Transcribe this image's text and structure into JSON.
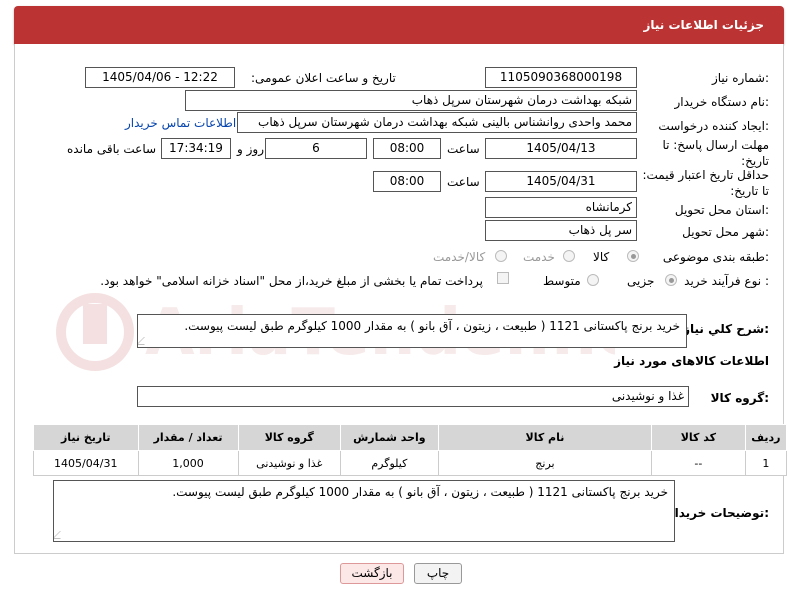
{
  "header": {
    "title": "جزئیات اطلاعات نیاز"
  },
  "fields": {
    "need_number_label": "شماره نیاز:",
    "need_number": "1105090368000198",
    "announce_label": "تاریخ و ساعت اعلان عمومی:",
    "announce_value": "1405/04/06 - 12:22",
    "buyer_org_label": "نام دستگاه خریدار:",
    "buyer_org": "شبکه بهداشت درمان شهرستان سرپل ذهاب",
    "creator_label": "ایجاد کننده درخواست:",
    "creator": "محمد واحدی روانشناس بالینی شبکه بهداشت درمان شهرستان سرپل ذهاب",
    "contact_link": "اطلاعات تماس خریدار",
    "deadline_label": "مهلت ارسال پاسخ: تا تاریخ:",
    "deadline_date": "1405/04/13",
    "time_word": "ساعت",
    "deadline_time": "08:00",
    "days_value": "6",
    "days_word": "روز و",
    "remaining_time": "17:34:19",
    "remaining_word": "ساعت باقی مانده",
    "price_validity_label": "حداقل تاریخ اعتبار قیمت: تا تاریخ:",
    "price_validity_date": "1405/04/31",
    "price_validity_time": "08:00",
    "province_label": "استان محل تحویل:",
    "province": "کرمانشاه",
    "city_label": "شهر محل تحویل:",
    "city": "سر پل ذهاب",
    "category_label": "طبقه بندی موضوعی:",
    "category_options": [
      "کالا",
      "خدمت",
      "کالا/خدمت"
    ],
    "process_label": "نوع فرآیند خرید :",
    "process_options": [
      "جزیی",
      "متوسط"
    ],
    "payment_note": "پرداخت تمام یا بخشی از مبلغ خرید،از محل \"اسناد خزانه اسلامی\" خواهد بود."
  },
  "summary": {
    "label": "شرح كلي نياز:",
    "text": "خرید برنج پاکستانی 1121 ( طبیعت ، زیتون ، آق بانو ) به مقدار 1000 کیلوگرم طبق لیست پیوست."
  },
  "goods_section": {
    "title": "اطلاعات کالاهای مورد نیاز",
    "group_label": "گروه کالا:",
    "group_value": "غذا و نوشیدنی"
  },
  "table": {
    "headers": [
      "ردیف",
      "کد کالا",
      "نام کالا",
      "واحد شمارش",
      "گروه کالا",
      "تعداد / مقدار",
      "تاریخ نیاز"
    ],
    "rows": [
      [
        "1",
        "--",
        "برنج",
        "کیلوگرم",
        "غذا و نوشیدنی",
        "1,000",
        "1405/04/31"
      ]
    ]
  },
  "buyer_notes": {
    "label": "توضیحات خریدار:",
    "text": "خرید برنج پاکستانی 1121 ( طبیعت ، زیتون ، آق بانو ) به مقدار 1000 کیلوگرم طبق لیست پیوست."
  },
  "buttons": {
    "print": "چاپ",
    "back": "بازگشت"
  },
  "watermark": "AriaTender.net",
  "colors": {
    "header": "#b33333",
    "link": "#0645ad",
    "watermark": "#e6b8b8"
  }
}
